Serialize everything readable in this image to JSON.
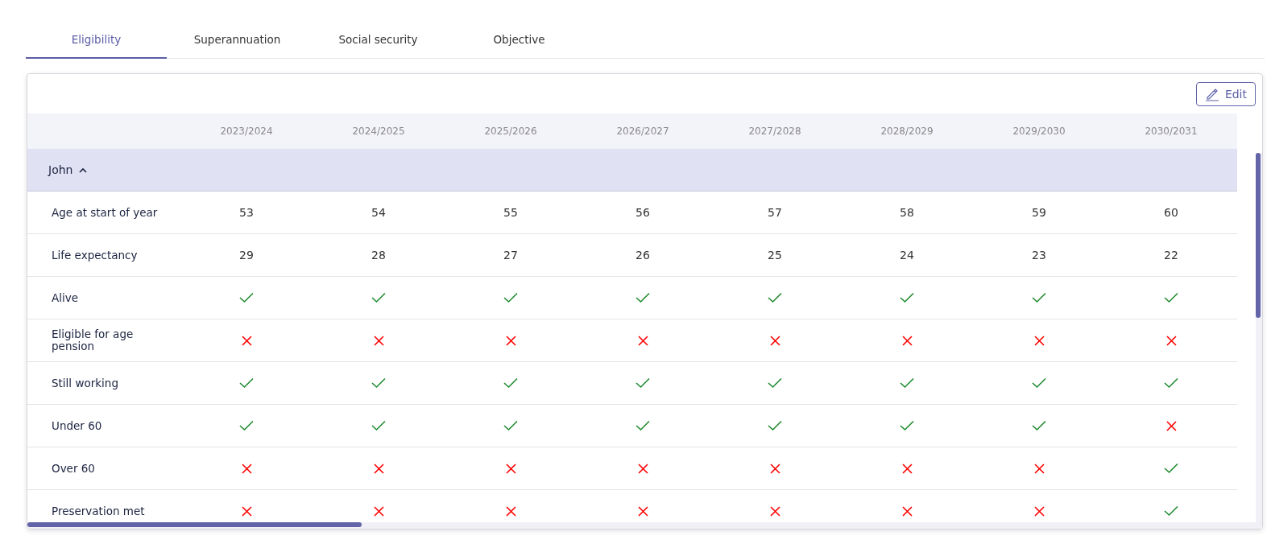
{
  "tabs": [
    {
      "label": "Eligibility",
      "selected": true
    },
    {
      "label": "Superannuation",
      "selected": false
    },
    {
      "label": "Social security",
      "selected": false
    },
    {
      "label": "Objective",
      "selected": false
    }
  ],
  "edit_button": {
    "label": "Edit"
  },
  "table": {
    "columns": [
      "2023/2024",
      "2024/2025",
      "2025/2026",
      "2026/2027",
      "2027/2028",
      "2028/2029",
      "2029/2030",
      "2030/2031"
    ],
    "group": {
      "name": "John",
      "expanded": true
    },
    "rows": [
      {
        "label": "Age at start of year",
        "kind": "number",
        "values": [
          "53",
          "54",
          "55",
          "56",
          "57",
          "58",
          "59",
          "60"
        ]
      },
      {
        "label": "Life expectancy",
        "kind": "number",
        "values": [
          "29",
          "28",
          "27",
          "26",
          "25",
          "24",
          "23",
          "22"
        ]
      },
      {
        "label": "Alive",
        "kind": "flag",
        "values": [
          true,
          true,
          true,
          true,
          true,
          true,
          true,
          true
        ]
      },
      {
        "label": "Eligible for age pension",
        "kind": "flag",
        "values": [
          false,
          false,
          false,
          false,
          false,
          false,
          false,
          false
        ]
      },
      {
        "label": "Still working",
        "kind": "flag",
        "values": [
          true,
          true,
          true,
          true,
          true,
          true,
          true,
          true
        ]
      },
      {
        "label": "Under 60",
        "kind": "flag",
        "values": [
          true,
          true,
          true,
          true,
          true,
          true,
          true,
          false
        ]
      },
      {
        "label": "Over 60",
        "kind": "flag",
        "values": [
          false,
          false,
          false,
          false,
          false,
          false,
          false,
          true
        ]
      },
      {
        "label": "Preservation met",
        "kind": "flag",
        "values": [
          false,
          false,
          false,
          false,
          false,
          false,
          false,
          true
        ]
      }
    ]
  }
}
